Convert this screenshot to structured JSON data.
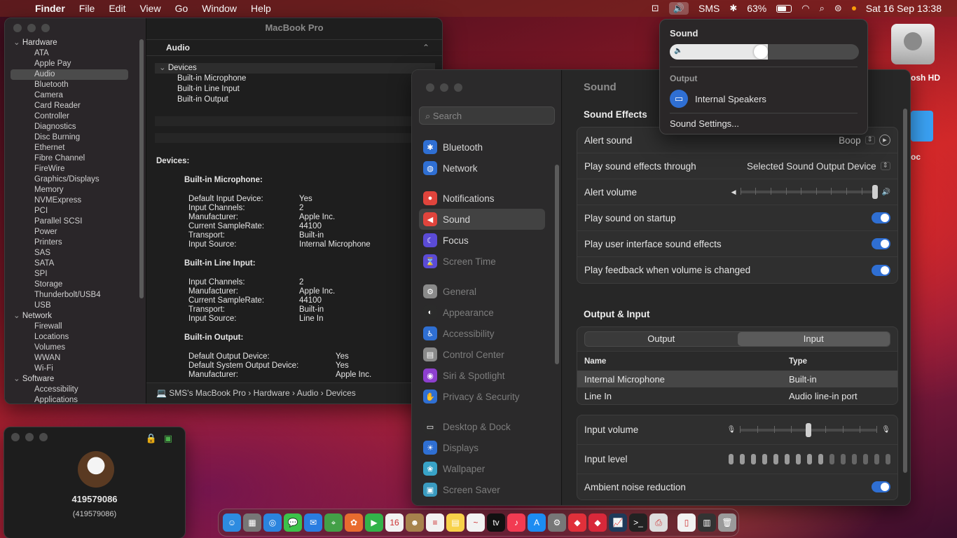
{
  "menubar": {
    "apple": "",
    "items": [
      "Finder",
      "File",
      "Edit",
      "View",
      "Go",
      "Window",
      "Help"
    ],
    "user": "SMS",
    "battery": "63%",
    "datetime": "Sat 16 Sep  13:38"
  },
  "sysinfo": {
    "window_title": "MacBook Pro",
    "tree": [
      {
        "section": "Hardware",
        "items": [
          "ATA",
          "Apple Pay",
          "Audio",
          "Bluetooth",
          "Camera",
          "Card Reader",
          "Controller",
          "Diagnostics",
          "Disc Burning",
          "Ethernet",
          "Fibre Channel",
          "FireWire",
          "Graphics/Displays",
          "Memory",
          "NVMExpress",
          "PCI",
          "Parallel SCSI",
          "Power",
          "Printers",
          "SAS",
          "SATA",
          "SPI",
          "Storage",
          "Thunderbolt/USB4",
          "USB"
        ]
      },
      {
        "section": "Network",
        "items": [
          "Firewall",
          "Locations",
          "Volumes",
          "WWAN",
          "Wi-Fi"
        ]
      },
      {
        "section": "Software",
        "items": [
          "Accessibility",
          "Applications"
        ]
      }
    ],
    "selected_item": "Audio",
    "header": "Audio",
    "devices_group": "Devices",
    "device_rows": [
      "Built-in Microphone",
      "Built-in Line Input",
      "Built-in Output"
    ],
    "detail_title": "Devices:",
    "detail": [
      {
        "name": "Built-in Microphone:",
        "props": [
          [
            "Default Input Device:",
            "Yes"
          ],
          [
            "Input Channels:",
            "2"
          ],
          [
            "Manufacturer:",
            "Apple Inc."
          ],
          [
            "Current SampleRate:",
            "44100"
          ],
          [
            "Transport:",
            "Built-in"
          ],
          [
            "Input Source:",
            "Internal Microphone"
          ]
        ]
      },
      {
        "name": "Built-in Line Input:",
        "props": [
          [
            "Input Channels:",
            "2"
          ],
          [
            "Manufacturer:",
            "Apple Inc."
          ],
          [
            "Current SampleRate:",
            "44100"
          ],
          [
            "Transport:",
            "Built-in"
          ],
          [
            "Input Source:",
            "Line In"
          ]
        ]
      },
      {
        "name": "Built-in Output:",
        "props": [
          [
            "Default Output Device:",
            "Yes"
          ],
          [
            "Default System Output Device:",
            "Yes"
          ],
          [
            "Manufacturer:",
            "Apple Inc."
          ]
        ]
      }
    ],
    "path": [
      "SMS's MacBook Pro",
      "Hardware",
      "Audio",
      "Devices"
    ]
  },
  "contact": {
    "name": "419579086",
    "sub": "(419579086)"
  },
  "settings": {
    "search_placeholder": "Search",
    "nav": [
      {
        "label": "Bluetooth",
        "icon": "bluetooth-icon",
        "color": "#2f6fd3",
        "glyph": "✱"
      },
      {
        "label": "Network",
        "icon": "globe-icon",
        "color": "#2f6fd3",
        "glyph": "◍"
      },
      {
        "gap": true
      },
      {
        "label": "Notifications",
        "icon": "bell-icon",
        "color": "#e0443c",
        "glyph": "●"
      },
      {
        "label": "Sound",
        "icon": "speaker-icon",
        "color": "#e0443c",
        "glyph": "◀",
        "selected": true
      },
      {
        "label": "Focus",
        "icon": "moon-icon",
        "color": "#5b4bd6",
        "glyph": "☾"
      },
      {
        "label": "Screen Time",
        "icon": "hourglass-icon",
        "color": "#5b4bd6",
        "glyph": "⌛"
      },
      {
        "gap": true
      },
      {
        "label": "General",
        "icon": "gear-icon",
        "color": "#8a8a8a",
        "glyph": "⚙"
      },
      {
        "label": "Appearance",
        "icon": "appearance-icon",
        "color": "#2b2b2b",
        "glyph": "◐"
      },
      {
        "label": "Accessibility",
        "icon": "accessibility-icon",
        "color": "#2f6fd3",
        "glyph": "♿"
      },
      {
        "label": "Control Center",
        "icon": "control-center-icon",
        "color": "#8a8a8a",
        "glyph": "▤"
      },
      {
        "label": "Siri & Spotlight",
        "icon": "siri-icon",
        "color": "#8e3fcf",
        "glyph": "◉"
      },
      {
        "label": "Privacy & Security",
        "icon": "hand-icon",
        "color": "#2f6fd3",
        "glyph": "✋"
      },
      {
        "gap": true
      },
      {
        "label": "Desktop & Dock",
        "icon": "dock-icon",
        "color": "#2b2b2b",
        "glyph": "▭"
      },
      {
        "label": "Displays",
        "icon": "display-icon",
        "color": "#2f6fd3",
        "glyph": "☀"
      },
      {
        "label": "Wallpaper",
        "icon": "wallpaper-icon",
        "color": "#38a3c7",
        "glyph": "❀"
      },
      {
        "label": "Screen Saver",
        "icon": "screensaver-icon",
        "color": "#3a9bc0",
        "glyph": "▣"
      }
    ],
    "title": "Sound",
    "effects_title": "Sound Effects",
    "alert_sound_label": "Alert sound",
    "alert_sound_value": "Boop",
    "play_through_label": "Play sound effects through",
    "play_through_value": "Selected Sound Output Device",
    "alert_volume_label": "Alert volume",
    "alert_volume_level": 1.0,
    "startup_label": "Play sound on startup",
    "startup_on": true,
    "ui_sounds_label": "Play user interface sound effects",
    "ui_sounds_on": true,
    "feedback_label": "Play feedback when volume is changed",
    "feedback_on": true,
    "oi_title": "Output & Input",
    "seg_output": "Output",
    "seg_input": "Input",
    "col_name": "Name",
    "col_type": "Type",
    "devices": [
      {
        "name": "Internal Microphone",
        "type": "Built-in",
        "selected": true
      },
      {
        "name": "Line In",
        "type": "Audio line-in port",
        "selected": false
      }
    ],
    "input_volume_label": "Input volume",
    "input_volume_level": 0.5,
    "input_level_label": "Input level",
    "input_level_lit": 9,
    "input_level_total": 15,
    "noise_label": "Ambient noise reduction",
    "noise_on": true
  },
  "popover": {
    "title": "Sound",
    "volume_level": 0.52,
    "output_label": "Output",
    "output_device": "Internal Speakers",
    "settings_link": "Sound Settings..."
  },
  "desktop": {
    "hd_label": "osh HD",
    "folder_label": "oc"
  },
  "dock": [
    {
      "name": "finder-icon",
      "color": "#2d8be0",
      "glyph": "☺"
    },
    {
      "name": "launchpad-icon",
      "color": "#777",
      "glyph": "▦"
    },
    {
      "name": "safari-icon",
      "color": "#2b84de",
      "glyph": "◎"
    },
    {
      "name": "messages-icon",
      "color": "#3cc24a",
      "glyph": "💬"
    },
    {
      "name": "mail-icon",
      "color": "#2a7de1",
      "glyph": "✉"
    },
    {
      "name": "maps-icon",
      "color": "#43a047",
      "glyph": "⌖"
    },
    {
      "name": "photos-icon",
      "color": "#e86b2f",
      "glyph": "✿"
    },
    {
      "name": "facetime-icon",
      "color": "#32b34a",
      "glyph": "▶"
    },
    {
      "name": "calendar-icon",
      "color": "#f2f2f2",
      "glyph": "16"
    },
    {
      "name": "contacts-icon",
      "color": "#a7834d",
      "glyph": "☻"
    },
    {
      "name": "reminders-icon",
      "color": "#f2f2f2",
      "glyph": "≡"
    },
    {
      "name": "notes-icon",
      "color": "#f7d24a",
      "glyph": "▤"
    },
    {
      "name": "freeform-icon",
      "color": "#f2f2f2",
      "glyph": "~"
    },
    {
      "name": "appletv-icon",
      "color": "#111",
      "glyph": "tv"
    },
    {
      "name": "music-icon",
      "color": "#f23b52",
      "glyph": "♪"
    },
    {
      "name": "appstore-icon",
      "color": "#1c8cf2",
      "glyph": "A"
    },
    {
      "name": "system-settings-icon",
      "color": "#777",
      "glyph": "⚙"
    },
    {
      "name": "app-red-icon",
      "color": "#e0303a",
      "glyph": "◆"
    },
    {
      "name": "app-red2-icon",
      "color": "#d8283a",
      "glyph": "◆"
    },
    {
      "name": "activity-monitor-icon",
      "color": "#1f3a5a",
      "glyph": "📈"
    },
    {
      "name": "terminal-icon",
      "color": "#222",
      "glyph": ">_"
    },
    {
      "name": "printer-icon",
      "color": "#ddd",
      "glyph": "⎙"
    },
    {
      "sep": true
    },
    {
      "name": "document-icon",
      "color": "#f2f2f2",
      "glyph": "▯"
    },
    {
      "name": "downloads-stack-icon",
      "color": "#333",
      "glyph": "▥"
    },
    {
      "name": "trash-icon",
      "color": "#9a9a9a",
      "glyph": "🗑"
    }
  ]
}
